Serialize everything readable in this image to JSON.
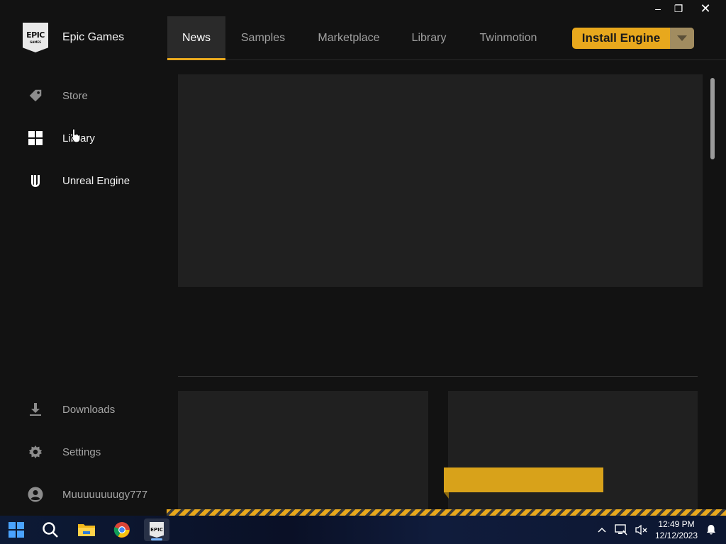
{
  "window_controls": {
    "minimize": "–",
    "restore": "❐",
    "close": "✕"
  },
  "sidebar": {
    "brand": {
      "logo_text": "EPIC",
      "logo_subtext": "GAMES",
      "name": "Epic Games"
    },
    "items": [
      {
        "label": "Store",
        "icon": "tag-icon"
      },
      {
        "label": "Library",
        "icon": "grid-icon"
      },
      {
        "label": "Unreal Engine",
        "icon": "unreal-engine-icon"
      }
    ],
    "bottom_items": [
      {
        "label": "Downloads",
        "icon": "download-icon"
      },
      {
        "label": "Settings",
        "icon": "gear-icon"
      },
      {
        "label": "Muuuuuuuugy777",
        "icon": "account-icon"
      }
    ]
  },
  "tabs": [
    {
      "label": "News",
      "active": true
    },
    {
      "label": "Samples",
      "active": false
    },
    {
      "label": "Marketplace",
      "active": false
    },
    {
      "label": "Library",
      "active": false
    },
    {
      "label": "Twinmotion",
      "active": false
    }
  ],
  "install_button": {
    "label": "Install Engine",
    "dropdown": "chevron-down-icon"
  },
  "taskbar": {
    "apps": [
      "windows-start-icon",
      "search-icon",
      "file-explorer-icon",
      "chrome-icon",
      "epic-games-launcher-icon"
    ],
    "epic_label": "EPIC",
    "tray": [
      "chevron-up-icon",
      "network-icon",
      "volume-muted-icon",
      "notification-bell-icon"
    ],
    "time": "12:49 PM",
    "date": "12/12/2023"
  },
  "colors": {
    "accent": "#e8a81d",
    "background": "#121212",
    "panel": "#202020",
    "tab_active": "#2a2a2a"
  }
}
